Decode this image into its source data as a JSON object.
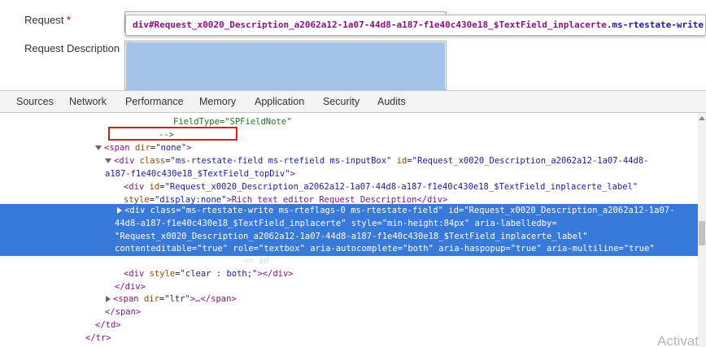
{
  "form": {
    "request_label": "Request",
    "required_star": "*",
    "description_label": "Request Description"
  },
  "tooltip": {
    "tag": "div",
    "id": "#Request_x0020_Description_a2062a12-1a07-44d8-a187-f1e40c430e18_$TextField_inplacerte",
    "classes": ".ms-rtestate-write.ms-rteflag"
  },
  "tabs": [
    "Sources",
    "Network",
    "Performance",
    "Memory",
    "Application",
    "Security",
    "Audits"
  ],
  "tree": {
    "l1": "FieldType=\"SPFieldNote\"",
    "l2": "-->",
    "l3_tag": "<span ",
    "l3_attr": "dir",
    "l3_val": "\"none\"",
    "l3_end": ">",
    "l4_tag": "<div ",
    "l4_a1": "class",
    "l4_v1": "\"ms-rtestate-field ms-rtefield ms-inputBox\"",
    "l4_a2": " id",
    "l4_v2": "\"Request_x0020_Description_a2062a12-1a07-44d8-",
    "l5_v": "a187-f1e40c430e18_$TextField_topDiv\"",
    "l5_end": ">",
    "l6_tag": "<div ",
    "l6_a": "id",
    "l6_v": "\"Request_x0020_Description_a2062a12-1a07-44d8-a187-f1e40c430e18_$TextField_inplacerte_label\"",
    "l7_a": "style",
    "l7_v": "\"display:none\"",
    "l7_text": ">Rich text editor Request Description</div>",
    "s1": "<div class=\"ms-rtestate-write ms-rteflags-0 ms-rtestate-field\" id=\"Request_x0020_Description_a2062a12-1a07-",
    "s2": "44d8-a187-f1e40c430e18_$TextField_inplacerte\" style=\"min-height:84px\" aria-labelledby=",
    "s3": "\"Request_x0020_Description_a2062a12-1a07-44d8-a187-f1e40c430e18_$TextField_inplacerte_label\"",
    "s4a": "contenteditable=\"true\"",
    "s4b": " role=\"textbox\" aria-autocomplete=\"both\" aria-haspopup=\"true\" aria-multiline=\"true\"",
    "s5a": "rtedirty=\"false\">…</div>",
    "s5b": " == $0",
    "l8_tag": "<div ",
    "l8_a": "style",
    "l8_v": "\"clear : both;\"",
    "l8_end": "></div>",
    "l9": "</div>",
    "l10_tag": "<span ",
    "l10_a": "dir",
    "l10_v": "\"ltr\"",
    "l10_end": ">…</span>",
    "l11": "</span>",
    "l12": "</td>",
    "l13": "</tr>"
  },
  "watermark": "Activat",
  "colors": {
    "selection": "#3879d9",
    "highlight_box": "#d51f1f",
    "overlay": "#a3c3e8"
  }
}
